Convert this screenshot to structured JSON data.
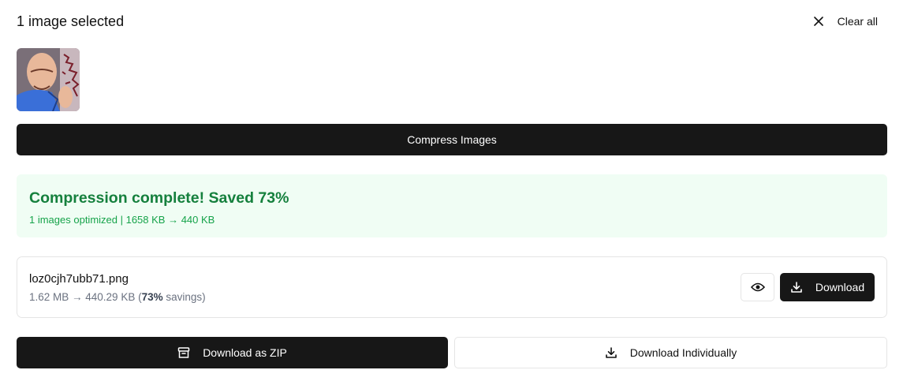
{
  "header": {
    "title": "1 image selected",
    "clear_label": "Clear all",
    "clear_icon": "close-icon"
  },
  "thumbnail": {
    "icon": "image-thumbnail",
    "colors": {
      "background": "#7a6f78",
      "skin": "#e8b89a",
      "shirt": "#3a6fd8"
    }
  },
  "compress_button": {
    "label": "Compress Images"
  },
  "result": {
    "title": "Compression complete! Saved 73%",
    "subtitle": "1 images optimized | 1658 KB → 440 KB",
    "colors": {
      "background": "#f0fdf4",
      "title": "#15803d",
      "subtitle": "#16a34a"
    }
  },
  "file": {
    "name": "loz0cjh7ubb71.png",
    "meta_prefix": "1.62 MB → 440.29 KB (",
    "meta_percent": "73%",
    "meta_suffix": " savings)",
    "preview_icon": "eye-icon",
    "download_label": "Download",
    "download_icon": "download-icon"
  },
  "actions": {
    "zip_label": "Download as ZIP",
    "zip_icon": "archive-icon",
    "individual_label": "Download Individually",
    "individual_icon": "download-icon"
  },
  "colors": {
    "primary": "#171717",
    "border": "#e5e5e5",
    "text": "#111111"
  }
}
